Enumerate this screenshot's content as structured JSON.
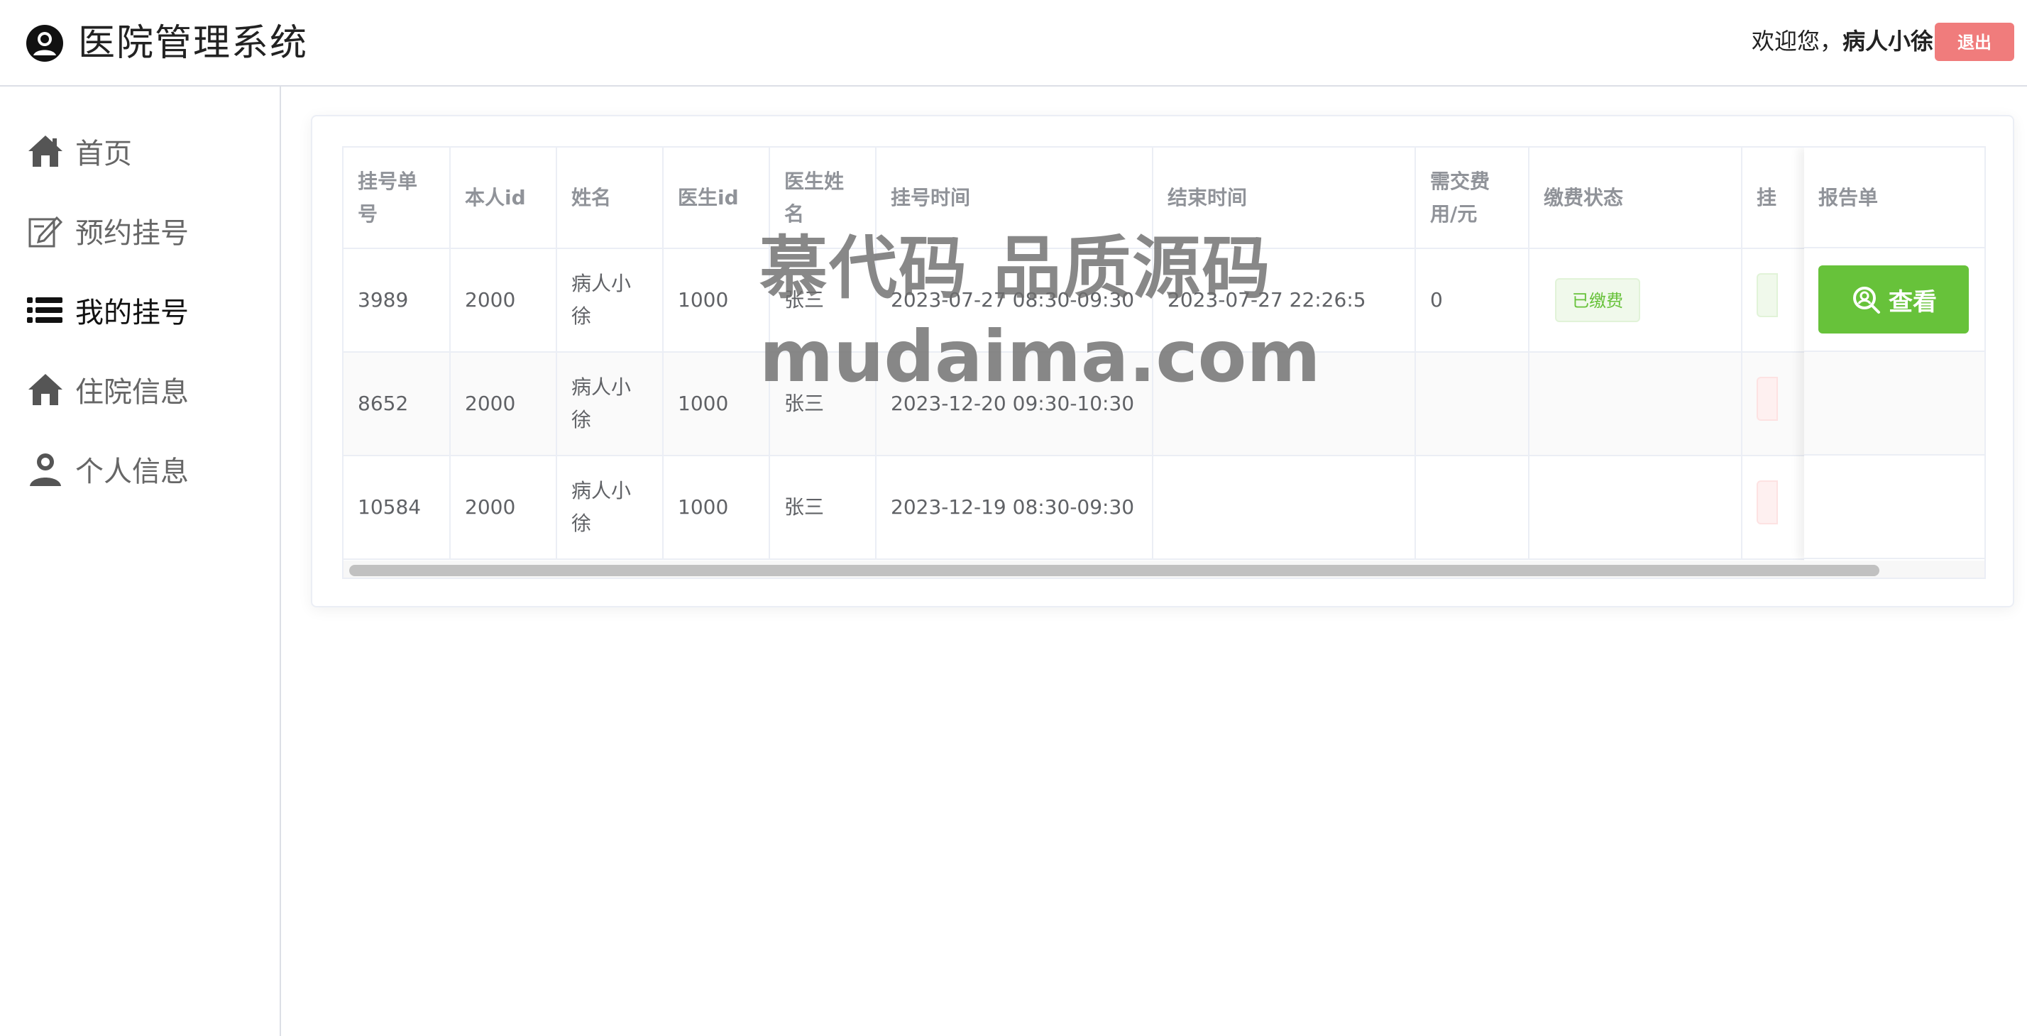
{
  "header": {
    "title": "医院管理系统",
    "welcome_prefix": "欢迎您，",
    "username": "病人小徐",
    "logout_label": "退出"
  },
  "sidebar": {
    "items": [
      {
        "label": "首页",
        "icon": "home-icon"
      },
      {
        "label": "预约挂号",
        "icon": "edit-icon"
      },
      {
        "label": "我的挂号",
        "icon": "list-icon"
      },
      {
        "label": "住院信息",
        "icon": "house-icon"
      },
      {
        "label": "个人信息",
        "icon": "user-icon"
      }
    ],
    "active_index": 2
  },
  "table": {
    "headers": [
      "挂号单号",
      "本人id",
      "姓名",
      "医生id",
      "医生姓名",
      "挂号时间",
      "结束时间",
      "需交费用/元",
      "缴费状态",
      "挂",
      "报告单"
    ],
    "rows": [
      {
        "id": "3989",
        "self_id": "2000",
        "name": "病人小徐",
        "doctor_id": "1000",
        "doctor_name": "张三",
        "reg_time": "2023-07-27 08:30-09:30",
        "end_time": "2023-07-27 22:26:5",
        "fee": "0",
        "pay_status": "已缴费"
      },
      {
        "id": "8652",
        "self_id": "2000",
        "name": "病人小徐",
        "doctor_id": "1000",
        "doctor_name": "张三",
        "reg_time": "2023-12-20 09:30-10:30",
        "end_time": "",
        "fee": "",
        "pay_status": ""
      },
      {
        "id": "10584",
        "self_id": "2000",
        "name": "病人小徐",
        "doctor_id": "1000",
        "doctor_name": "张三",
        "reg_time": "2023-12-19 08:30-09:30",
        "end_time": "",
        "fee": "",
        "pay_status": ""
      }
    ],
    "view_button_label": "查看"
  },
  "watermark": {
    "line1": "慕代码 品质源码",
    "line2": "mudaima.com"
  },
  "colors": {
    "success": "#67c23a",
    "danger_button": "#f07c7c",
    "border": "#ebeef5"
  }
}
